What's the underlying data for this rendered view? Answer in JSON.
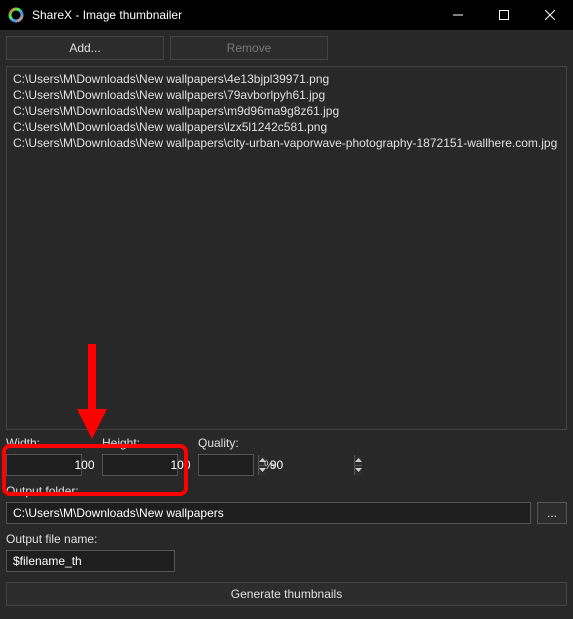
{
  "window": {
    "title": "ShareX - Image thumbnailer"
  },
  "buttons": {
    "add": "Add...",
    "remove": "Remove",
    "browse": "...",
    "generate": "Generate thumbnails"
  },
  "files": [
    "C:\\Users\\M\\Downloads\\New wallpapers\\4e13bjpl39971.png",
    "C:\\Users\\M\\Downloads\\New wallpapers\\79avborlpyh61.jpg",
    "C:\\Users\\M\\Downloads\\New wallpapers\\m9d96ma9g8z61.jpg",
    "C:\\Users\\M\\Downloads\\New wallpapers\\lzx5l1242c581.png",
    "C:\\Users\\M\\Downloads\\New wallpapers\\city-urban-vaporwave-photography-1872151-wallhere.com.jpg"
  ],
  "labels": {
    "width": "Width:",
    "height": "Height:",
    "quality": "Quality:",
    "percent": "%",
    "output_folder": "Output folder:",
    "output_filename": "Output file name:"
  },
  "values": {
    "width": "100",
    "height": "100",
    "quality": "90",
    "output_folder": "C:\\Users\\M\\Downloads\\New wallpapers",
    "output_filename": "$filename_th"
  }
}
